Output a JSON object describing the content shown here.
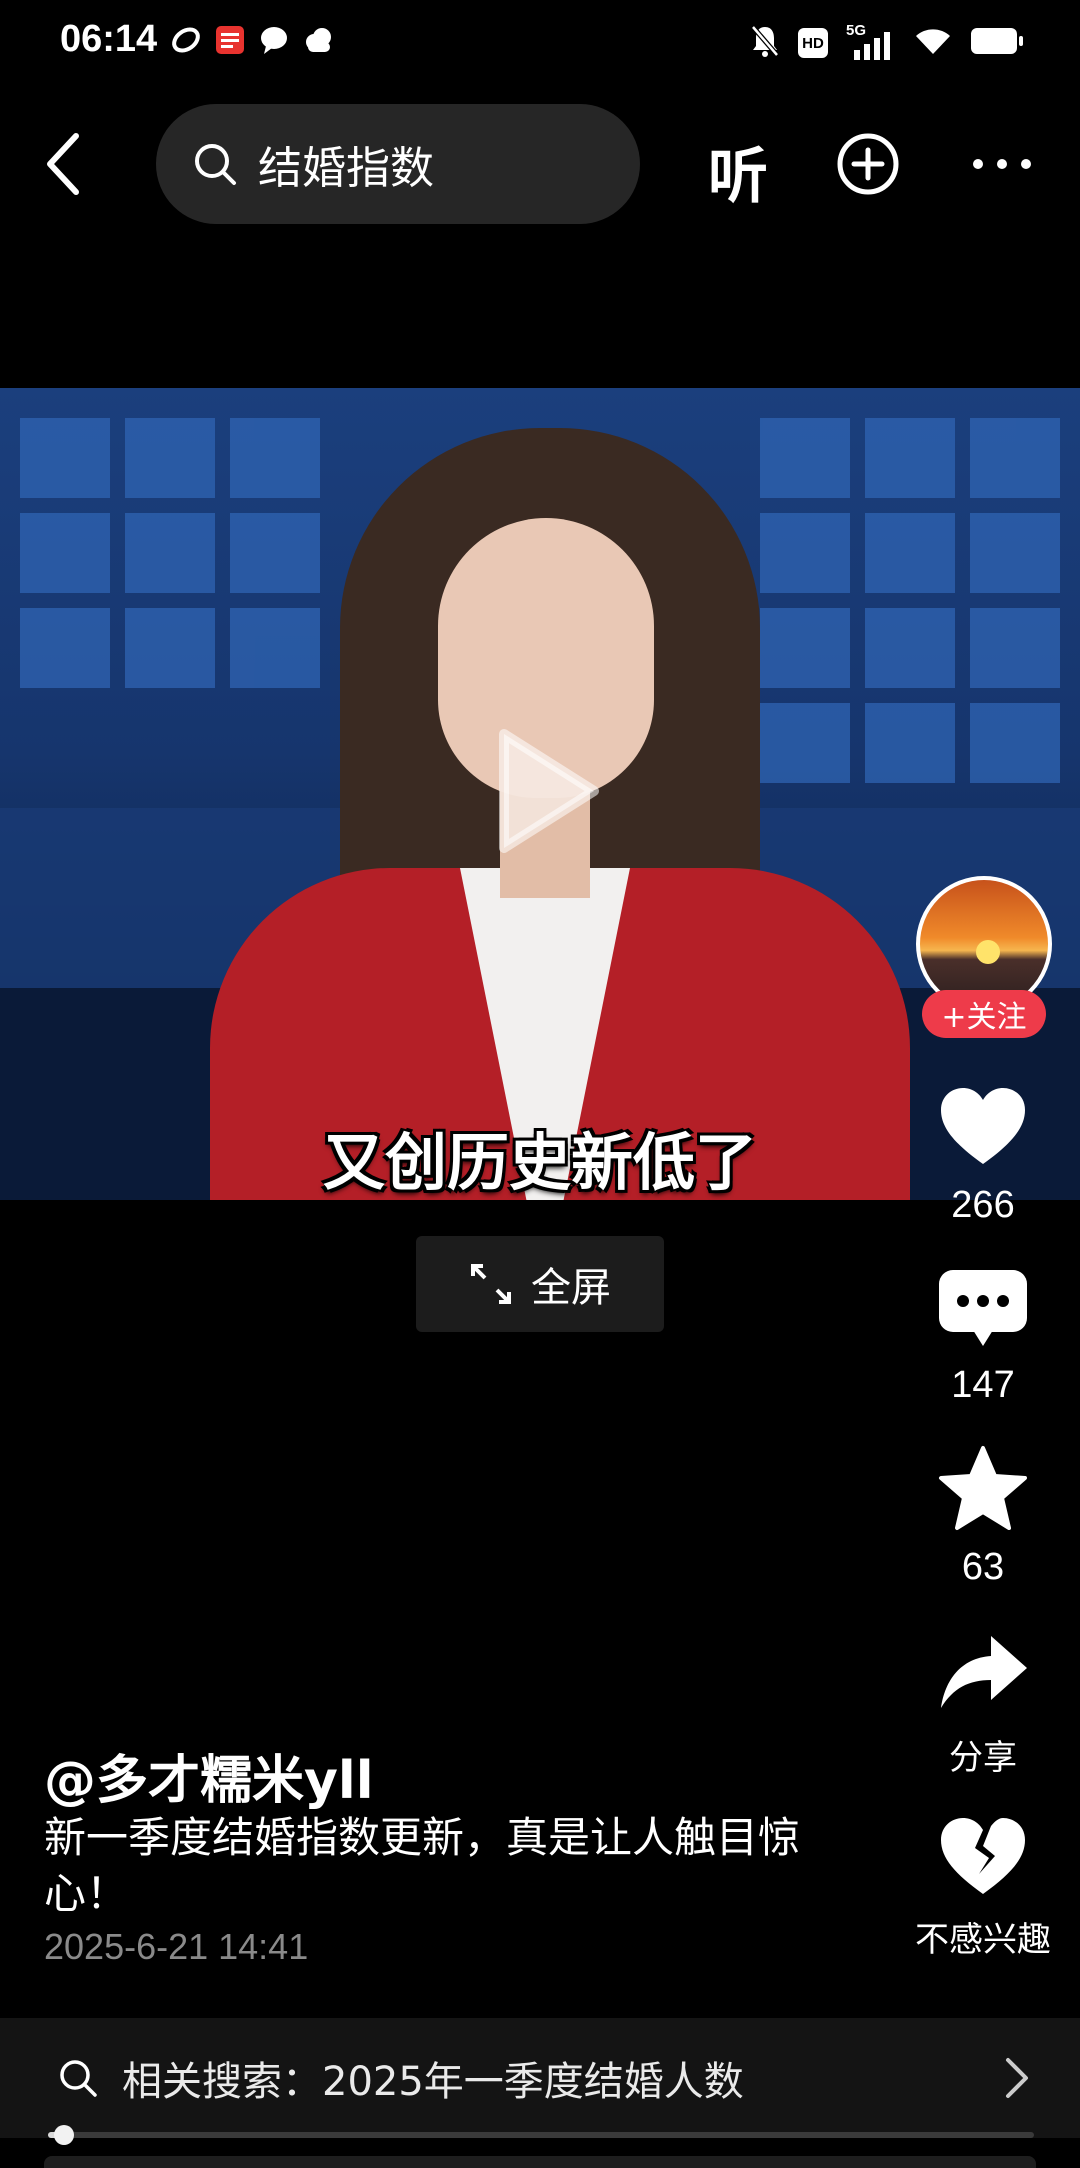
{
  "status_bar": {
    "time": "06:14",
    "left_icons": [
      "link-icon",
      "toutiao-app-icon",
      "chat-bubble-icon",
      "cloud-icon"
    ],
    "right_icons": [
      "mute-bell-icon",
      "hd-icon",
      "5g-signal-icon",
      "wifi-icon",
      "battery-icon"
    ],
    "hd_label": "HD",
    "network_label": "5G"
  },
  "top_nav": {
    "search_query": "结婚指数",
    "listen_label": "听"
  },
  "video": {
    "subtitle": "又创历史新低了",
    "fullscreen_label": "全屏"
  },
  "rail": {
    "follow_label": "+关注",
    "likes": "266",
    "comments": "147",
    "favorites": "63",
    "share_label": "分享",
    "not_interested_label": "不感兴趣"
  },
  "post": {
    "author": "@多才糯米yll",
    "description": "新一季度结婚指数更新，真是让人触目惊心！",
    "timestamp": "2025-6-21 14:41"
  },
  "related_search": {
    "text": "相关搜索：2025年一季度结婚人数"
  },
  "playback": {
    "progress": 0.016
  },
  "colors": {
    "background": "#000000",
    "follow_red": "#ee3b4a",
    "search_bg": "#262626"
  }
}
